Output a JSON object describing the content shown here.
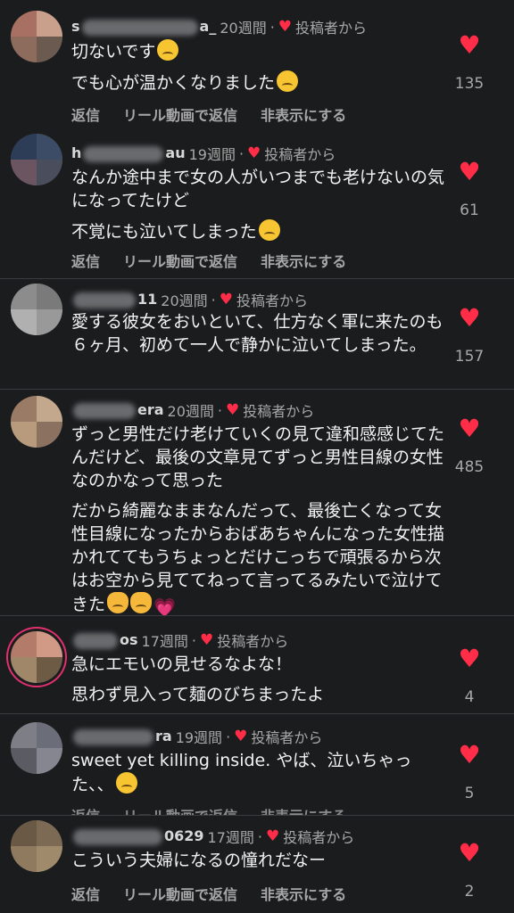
{
  "actions": {
    "reply": "返信",
    "reel_reply": "リール動画で返信",
    "hide": "非表示にする"
  },
  "badge": "投稿者から",
  "comments": [
    {
      "user_start": "s",
      "user_end": "a_",
      "time": "20週間",
      "lines": [
        "切ないです",
        "でも心が温かくなりました"
      ],
      "likes": "135"
    },
    {
      "user_start": "h",
      "user_end": "au",
      "time": "19週間",
      "lines": [
        "なんか途中まで女の人がいつまでも老けないの気になってたけど",
        "不覚にも泣いてしまった"
      ],
      "likes": "61"
    },
    {
      "user_start": "",
      "user_end": "11",
      "time": "20週間",
      "lines": [
        "愛する彼女をおいといて、仕方なく軍に来たのも６ヶ月、初めて一人で静かに泣いてしまった。"
      ],
      "likes": "157"
    },
    {
      "user_start": "",
      "user_end": "era",
      "time": "20週間",
      "lines": [
        "ずっと男性だけ老けていくの見て違和感感じてたんだけど、最後の文章見てずっと男性目線の女性なのかなって思った",
        "だから綺麗なままなんだって、最後亡くなって女性目線になったからおばあちゃんになった女性描かれててもうちょっとだけこっちで頑張るから次はお空から見ててねって言ってるみたいで泣けてきた"
      ],
      "likes": "485"
    },
    {
      "user_start": "",
      "user_end": "os",
      "time": "17週間",
      "lines": [
        "急にエモいの見せるなよな！",
        "思わず見入って麺のびちまったよ"
      ],
      "likes": "4"
    },
    {
      "user_start": "",
      "user_end": "ra",
      "time": "19週間",
      "lines": [
        "sweet yet killing inside. やば、泣いちゃった、、"
      ],
      "likes": "5"
    },
    {
      "user_start": "",
      "user_end": "0629",
      "time": "17週間",
      "lines": [
        "こういう夫婦になるの憧れだなー"
      ],
      "likes": "2"
    }
  ]
}
